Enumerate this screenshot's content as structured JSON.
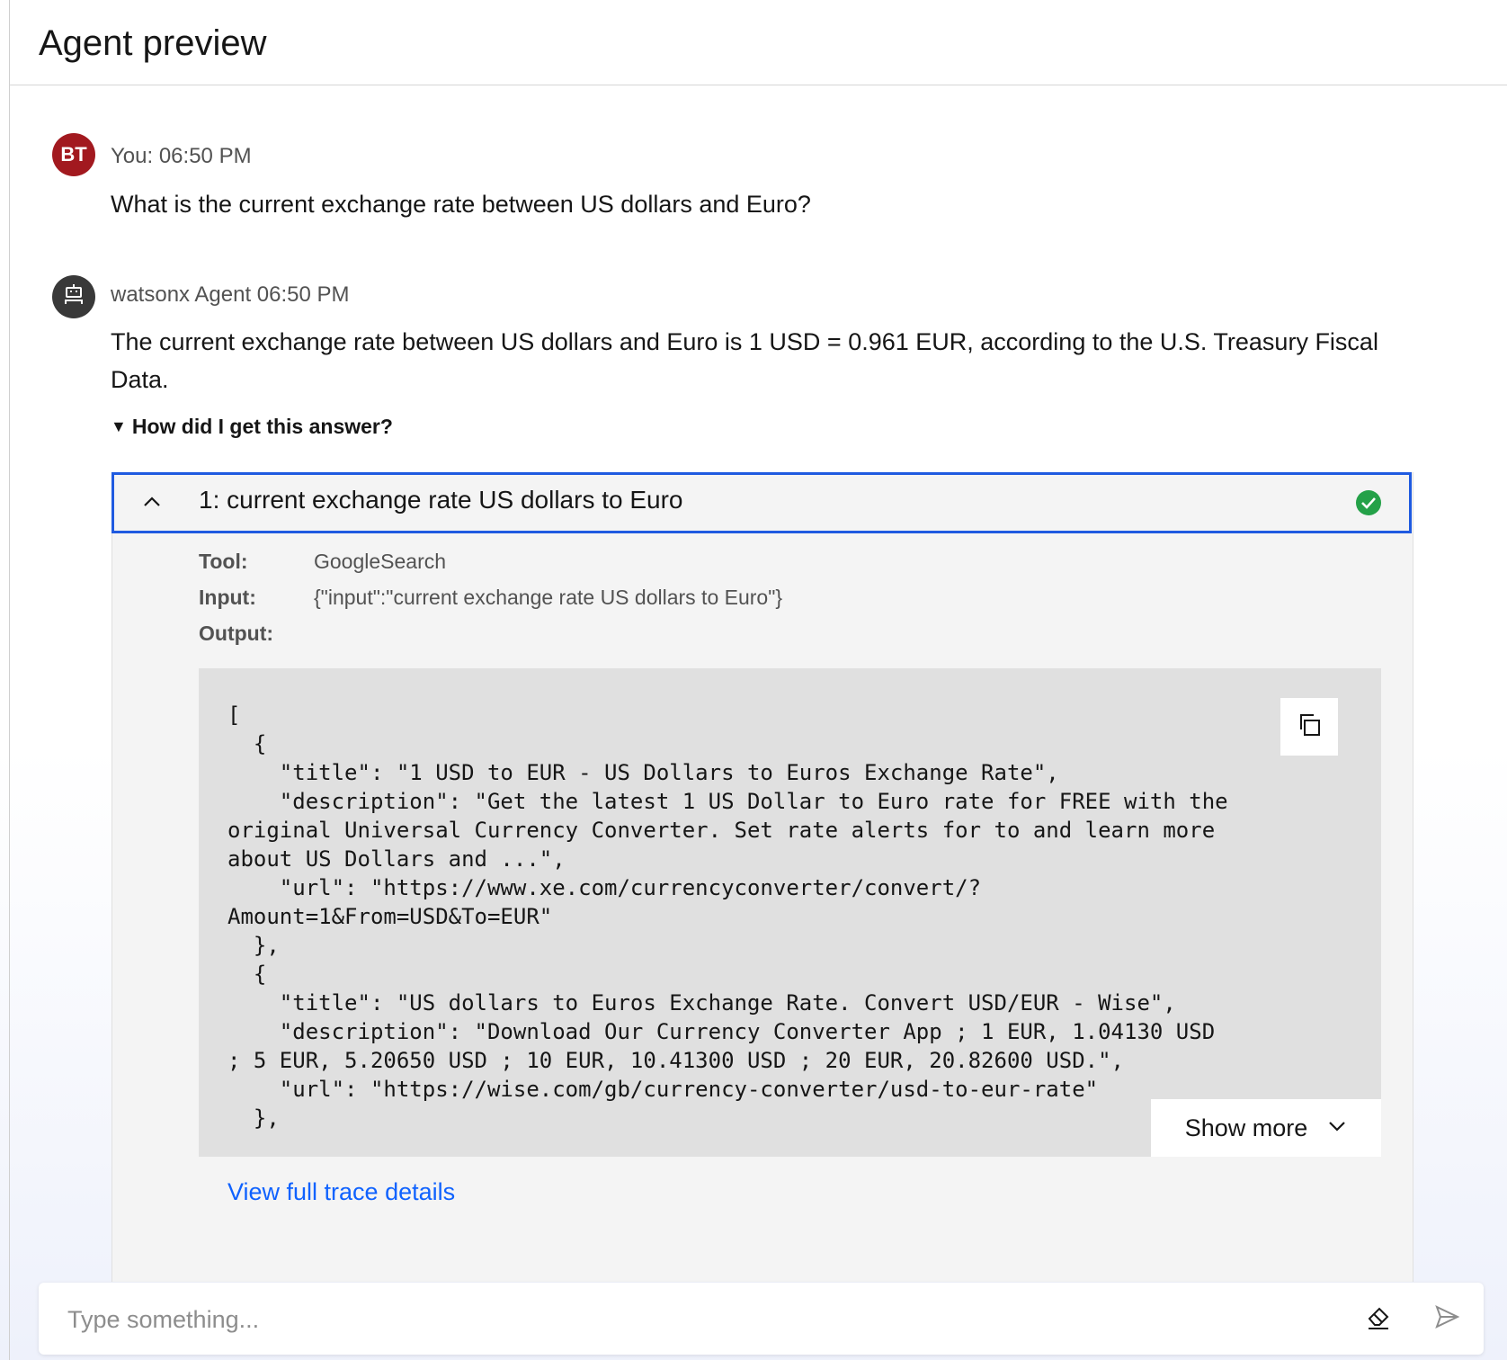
{
  "header": {
    "title": "Agent preview"
  },
  "user_message": {
    "avatar_initials": "BT",
    "meta": "You: 06:50 PM",
    "text": "What is the current exchange rate between US dollars and Euro?"
  },
  "agent_message": {
    "meta": "watsonx Agent 06:50 PM",
    "text_line1": "The current exchange rate between US dollars and Euro is 1 USD = 0.961 EUR, according to the U.S. Treasury Fiscal",
    "text_line2": "Data.",
    "toggle_label": "How did I get this answer?"
  },
  "step": {
    "title": "1:  current exchange rate US dollars to Euro",
    "status": "success",
    "tool_label": "Tool:",
    "tool_value": "GoogleSearch",
    "input_label": "Input:",
    "input_value": "{\"input\":\"current exchange rate US dollars to Euro\"}",
    "output_label": "Output:",
    "output_code": "[\n  {\n    \"title\": \"1 USD to EUR - US Dollars to Euros Exchange Rate\",\n    \"description\": \"Get the latest 1 US Dollar to Euro rate for FREE with the\noriginal Universal Currency Converter. Set rate alerts for to and learn more\nabout US Dollars and ...\",\n    \"url\": \"https://www.xe.com/currencyconverter/convert/?\nAmount=1&From=USD&To=EUR\"\n  },\n  {\n    \"title\": \"US dollars to Euros Exchange Rate. Convert USD/EUR - Wise\",\n    \"description\": \"Download Our Currency Converter App ; 1 EUR, 1.04130 USD\n; 5 EUR, 5.20650 USD ; 10 EUR, 10.41300 USD ; 20 EUR, 20.82600 USD.\",\n    \"url\": \"https://wise.com/gb/currency-converter/usd-to-eur-rate\"\n  },",
    "show_more_label": "Show more",
    "trace_link": "View full trace details"
  },
  "input_bar": {
    "placeholder": "Type something..."
  },
  "colors": {
    "accent_blue": "#0f62fe",
    "focus_border": "#1f5ae0",
    "user_avatar": "#a2191f",
    "agent_avatar": "#393939",
    "success": "#24a148"
  },
  "icons": [
    "robot-icon",
    "chevron-up-icon",
    "checkmark-filled-icon",
    "copy-icon",
    "chevron-down-icon",
    "eraser-icon",
    "send-icon"
  ]
}
